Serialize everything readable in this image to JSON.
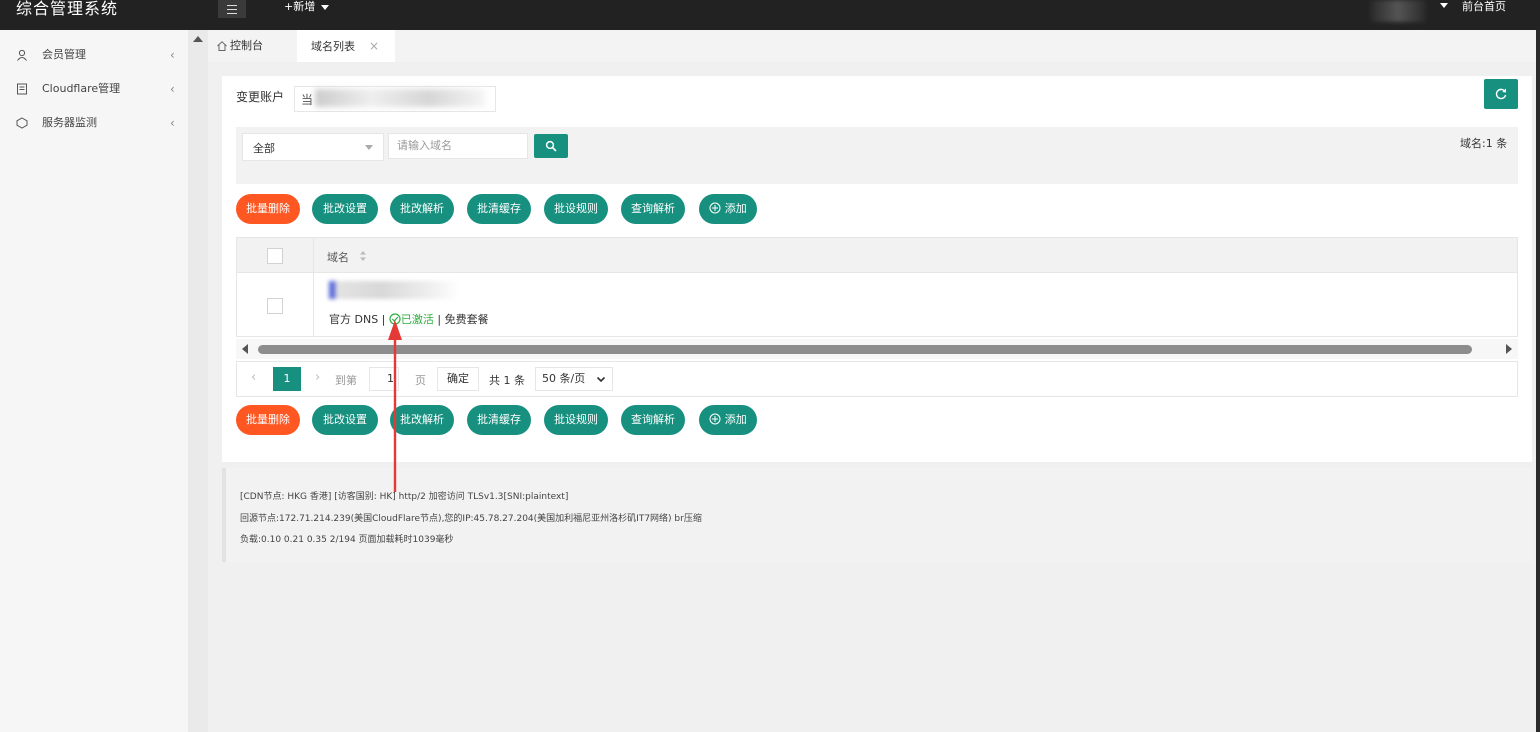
{
  "header": {
    "title": "综合管理系统",
    "new_label": "+新增",
    "front_link": "前台首页"
  },
  "sidebar": {
    "items": [
      {
        "label": "会员管理",
        "icon": "user-icon"
      },
      {
        "label": "Cloudflare管理",
        "icon": "document-icon"
      },
      {
        "label": "服务器监测",
        "icon": "monitor-icon"
      }
    ]
  },
  "tabs": [
    {
      "label": "控制台",
      "icon": "home-icon"
    },
    {
      "label": "域名列表",
      "close": "×"
    }
  ],
  "account": {
    "label": "变更账户",
    "value_visible": "当"
  },
  "filter": {
    "select_value": "全部",
    "domain_placeholder": "请输入域名",
    "count_text": "域名:1 条"
  },
  "actions": [
    "批量删除",
    "批改设置",
    "批改解析",
    "批清缓存",
    "批设规则",
    "查询解析",
    "添加"
  ],
  "table": {
    "header": "域名",
    "row": {
      "meta_prefix": "官方 DNS | ",
      "status": "已激活",
      "meta_suffix": " | 免费套餐"
    }
  },
  "pagination": {
    "current": "1",
    "goto_label": "到第",
    "goto_value": "1",
    "page_label": "页",
    "confirm": "确定",
    "total": "共 1 条",
    "page_size": "50 条/页"
  },
  "info": {
    "line1": "[CDN节点: HKG 香港] [访客国别: HK] http/2 加密访问 TLSv1.3[SNI:plaintext]",
    "line2": "回源节点:172.71.214.239(美国CloudFlare节点),您的IP:45.78.27.204(美国加利福尼亚州洛杉矶IT7网络) br压缩",
    "line3": "负载:0.10 0.21 0.35 2/194 页面加载耗时1039毫秒"
  },
  "colors": {
    "header_bg": "#222222",
    "primary": "#17907f",
    "danger": "#ff5722",
    "success": "#2eae3e",
    "annotation": "#e53935"
  }
}
